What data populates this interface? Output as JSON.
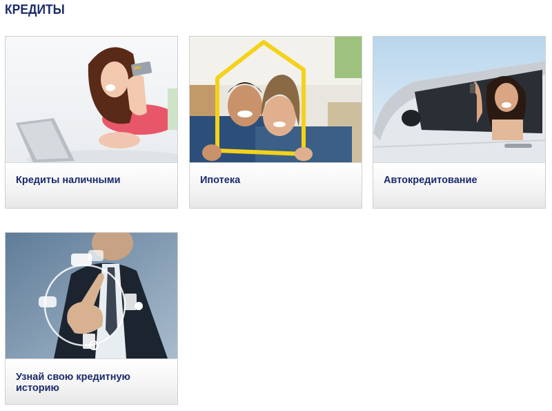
{
  "page": {
    "title": "КРЕДИТЫ"
  },
  "cards": [
    {
      "label": "Кредиты наличными",
      "image": "woman-with-laptop-and-card-photo"
    },
    {
      "label": "Ипотека",
      "image": "couple-with-house-frame-photo"
    },
    {
      "label": "Автокредитование",
      "image": "woman-in-car-with-keys-photo"
    },
    {
      "label": "Узнай свою кредитную историю",
      "image": "businessman-touch-interface-photo"
    }
  ],
  "colors": {
    "title": "#1a2a6c",
    "label": "#1a2a6c",
    "border": "#cfcfcf"
  }
}
